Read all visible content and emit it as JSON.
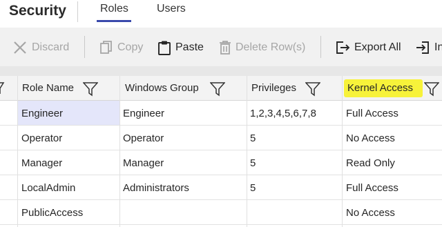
{
  "header": {
    "title": "Security",
    "tabs": [
      {
        "label": "Roles",
        "active": true
      },
      {
        "label": "Users",
        "active": false
      }
    ],
    "accent": "#3949ab"
  },
  "toolbar": {
    "discard": "Discard",
    "copy": "Copy",
    "paste": "Paste",
    "delete_rows": "Delete Row(s)",
    "export_all": "Export All",
    "import": "In"
  },
  "table": {
    "columns": [
      "Role Name",
      "Windows Group",
      "Privileges",
      "Kernel Access"
    ],
    "highlight_color": "#f7f23a",
    "rows": [
      {
        "role": "Engineer",
        "group": "Engineer",
        "privileges": "1,2,3,4,5,6,7,8",
        "kernel": "Full Access"
      },
      {
        "role": "Operator",
        "group": "Operator",
        "privileges": "5",
        "kernel": "No Access"
      },
      {
        "role": "Manager",
        "group": "Manager",
        "privileges": "5",
        "kernel": "Read Only"
      },
      {
        "role": "LocalAdmin",
        "group": "Administrators",
        "privileges": "5",
        "kernel": "Full Access"
      },
      {
        "role": "PublicAccess",
        "group": "",
        "privileges": "",
        "kernel": "No Access"
      }
    ]
  }
}
